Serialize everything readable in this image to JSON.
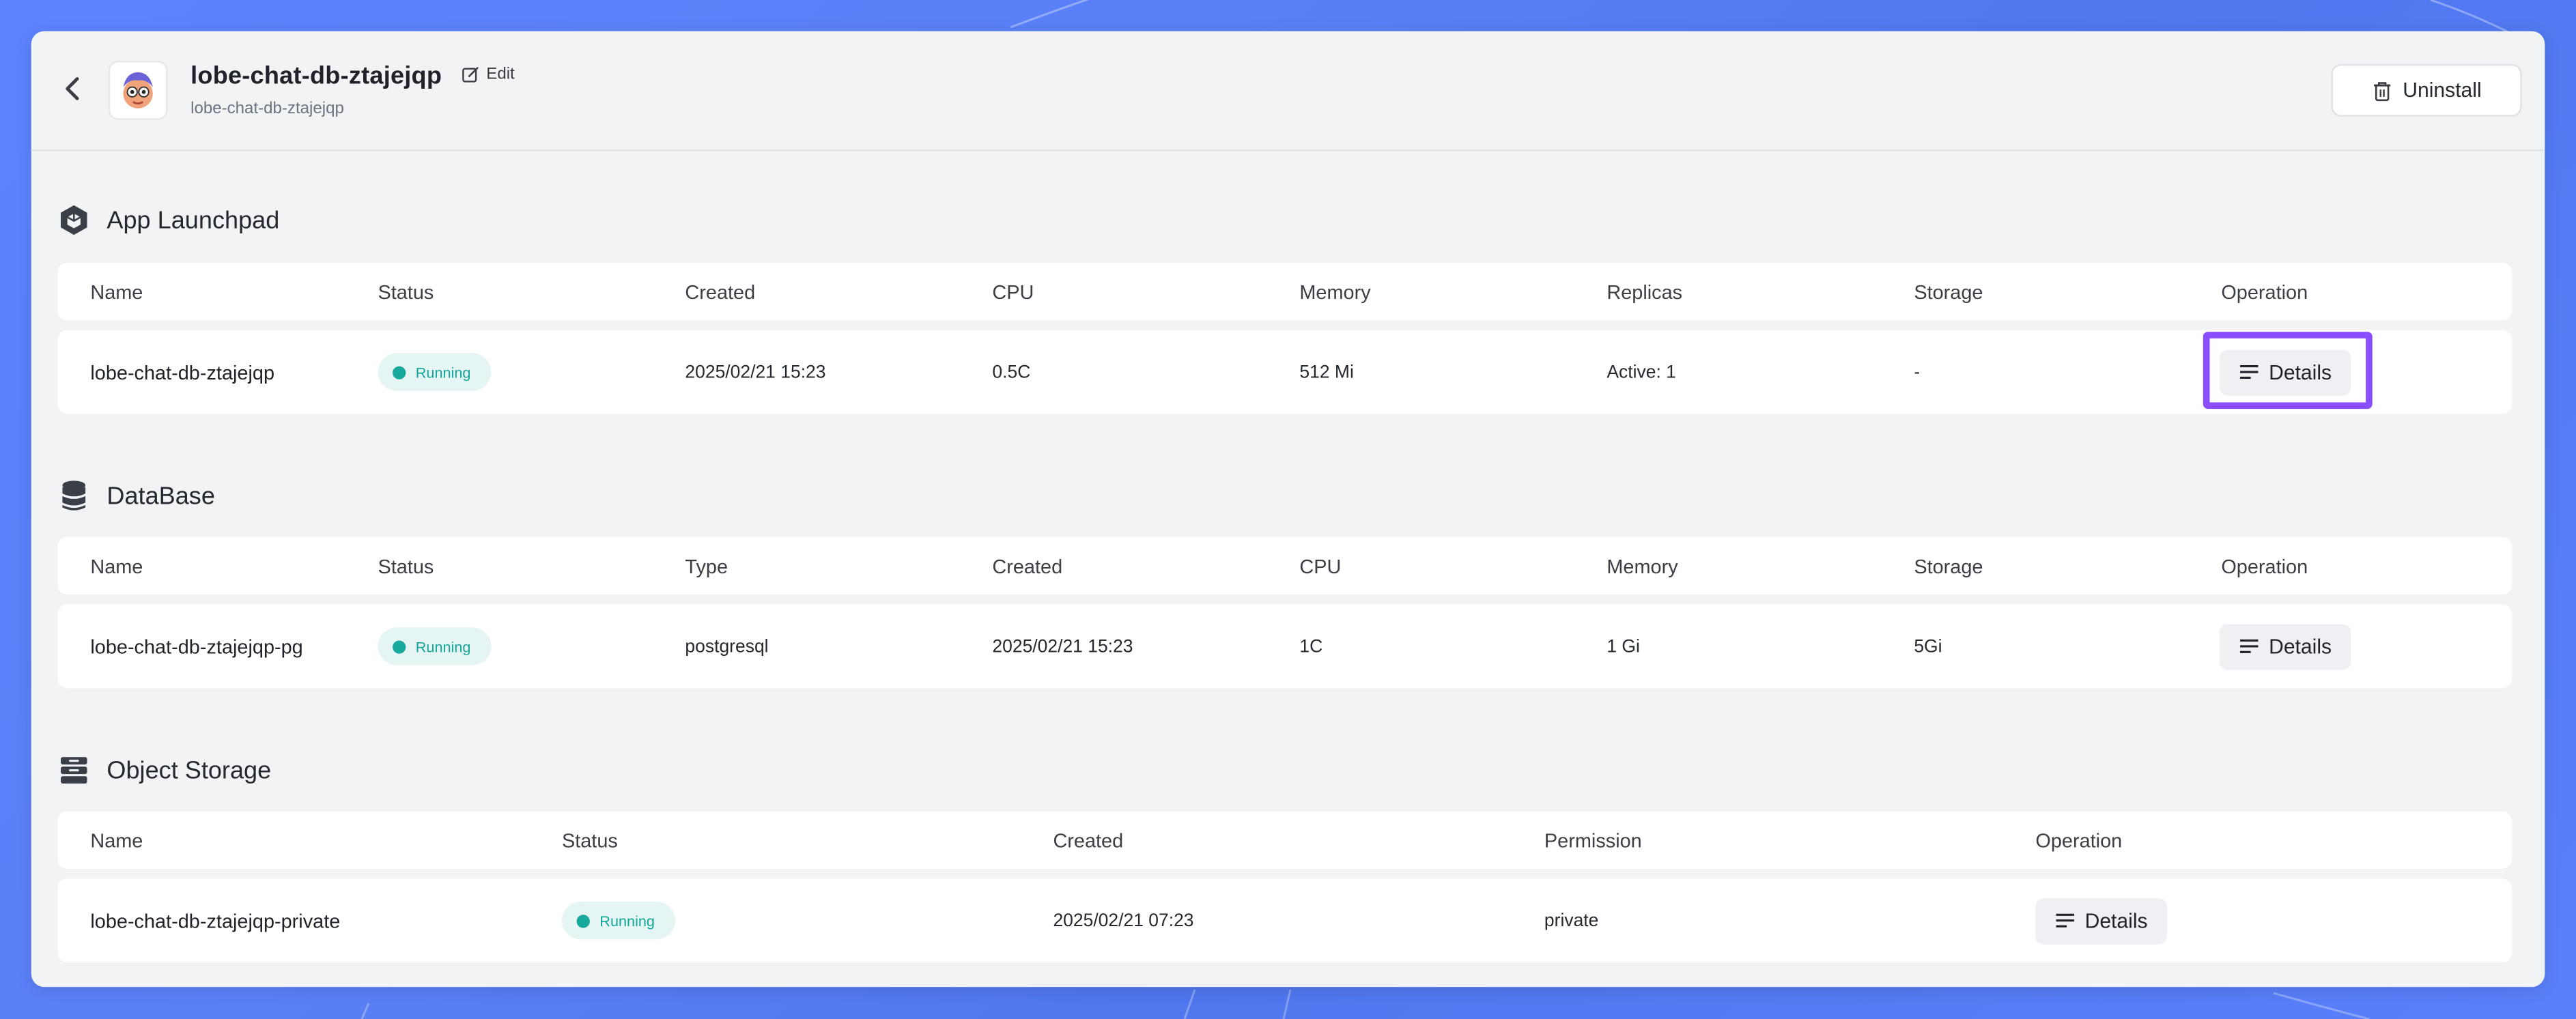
{
  "header": {
    "title": "lobe-chat-db-ztajejqp",
    "subtitle": "lobe-chat-db-ztajejqp",
    "edit_label": "Edit",
    "uninstall_label": "Uninstall"
  },
  "launchpad": {
    "title": "App Launchpad",
    "columns": [
      "Name",
      "Status",
      "Created",
      "CPU",
      "Memory",
      "Replicas",
      "Storage",
      "Operation"
    ],
    "row": {
      "name": "lobe-chat-db-ztajejqp",
      "status": "Running",
      "created": "2025/02/21 15:23",
      "cpu": "0.5C",
      "memory": "512 Mi",
      "replicas": "Active: 1",
      "storage": "-",
      "operation": "Details"
    }
  },
  "database": {
    "title": "DataBase",
    "columns": [
      "Name",
      "Status",
      "Type",
      "Created",
      "CPU",
      "Memory",
      "Storage",
      "Operation"
    ],
    "row": {
      "name": "lobe-chat-db-ztajejqp-pg",
      "status": "Running",
      "type": "postgresql",
      "created": "2025/02/21 15:23",
      "cpu": "1C",
      "memory": "1 Gi",
      "storage": "5Gi",
      "operation": "Details"
    }
  },
  "object_storage": {
    "title": "Object Storage",
    "columns": [
      "Name",
      "Status",
      "Created",
      "Permission",
      "Operation"
    ],
    "row": {
      "name": "lobe-chat-db-ztajejqp-private",
      "status": "Running",
      "created": "2025/02/21 07:23",
      "permission": "private",
      "operation": "Details"
    }
  },
  "colors": {
    "running": "#12a69b",
    "highlight": "#8a4dff",
    "background": "#5a80f7"
  }
}
